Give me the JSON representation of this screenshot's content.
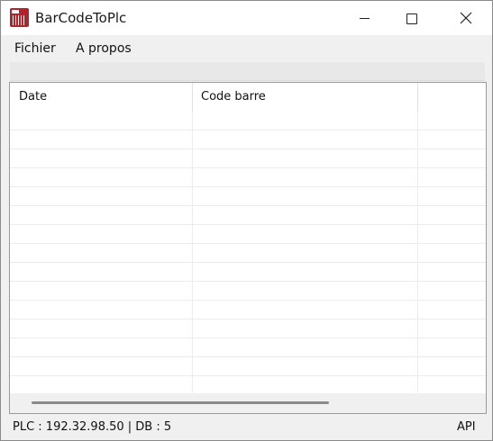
{
  "window": {
    "title": "BarCodeToPlc",
    "icon": "barcode-app-icon"
  },
  "menu": {
    "items": [
      {
        "label": "Fichier"
      },
      {
        "label": "A propos"
      }
    ]
  },
  "grid": {
    "columns": [
      {
        "label": "Date"
      },
      {
        "label": "Code barre"
      }
    ],
    "rows": []
  },
  "status": {
    "connection": "PLC : 192.32.98.50 | DB : 5",
    "mode": "API"
  },
  "colors": {
    "icon_red": "#b0242b",
    "window_bg": "#f0f0f0",
    "grid_line": "#ececec"
  }
}
